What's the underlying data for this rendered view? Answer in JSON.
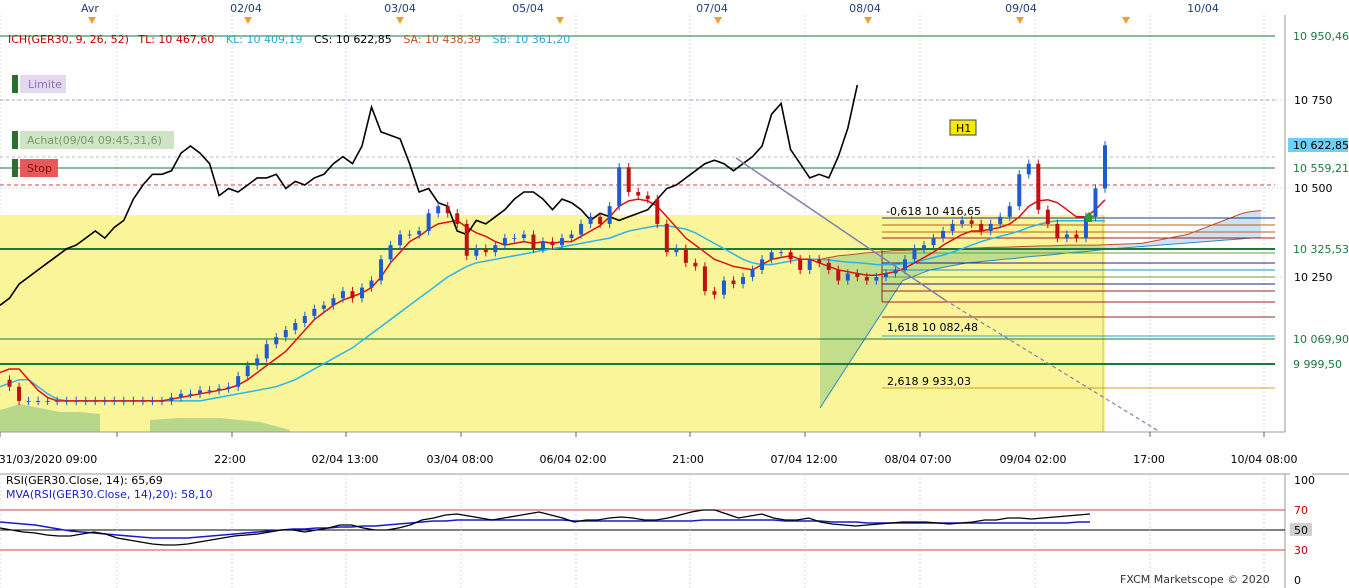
{
  "top_dates": [
    "Avr",
    "02/04",
    "03/04",
    "05/04",
    "07/04",
    "08/04",
    "09/04",
    "10/04"
  ],
  "header": {
    "ich": "ICH(GER30, 9, 26, 52)",
    "tl": "TL: 10 467,60",
    "kl": "KL: 10 409,19",
    "cs": "CS: 10 622,85",
    "sa": "SA: 10 438,39",
    "sb": "SB: 10 361,20"
  },
  "order_tags": {
    "limit": "Limite",
    "buy": "Achat(09/04 09:45,31,6)",
    "stop": "Stop"
  },
  "badge": "H1",
  "fib_labels": [
    "-0,618 10 416,65",
    "1,618 10 082,48",
    "2,618 9 933,03"
  ],
  "right_axis": {
    "labels": [
      "10 750",
      "10 500",
      "10 250"
    ],
    "tags": [
      {
        "text": "10 950,46",
        "bg": "#ffffff",
        "fg": "#1a7a3c"
      },
      {
        "text": "10 622,85",
        "bg": "#6fd0f5",
        "fg": "#000000"
      },
      {
        "text": "10 559,21",
        "bg": "#ffffff",
        "fg": "#1a7a3c"
      },
      {
        "text": "10 325,53",
        "bg": "#ffffff",
        "fg": "#1a7a3c"
      },
      {
        "text": "10 069,90",
        "bg": "#ffffff",
        "fg": "#1a7a3c"
      },
      {
        "text": "9 999,50",
        "bg": "#ffffff",
        "fg": "#1a7a3c"
      }
    ]
  },
  "bottom_axis": [
    "31/03/2020 09:00",
    "22:00",
    "02/04 13:00",
    "03/04 08:00",
    "06/04 02:00",
    "21:00",
    "07/04 12:00",
    "08/04 07:00",
    "09/04 02:00",
    "17:00",
    "10/04 08:00"
  ],
  "rsi": {
    "label1": "RSI(GER30.Close, 14): 65,69",
    "label2": "MVA(RSI(GER30.Close, 14),20): 58,10",
    "levels": [
      "100",
      "70",
      "50",
      "30",
      "0"
    ]
  },
  "footer": "FXCM Marketscope © 2020",
  "chart_data": {
    "type": "line",
    "instrument": "GER30",
    "y_range": [
      9880,
      11000
    ],
    "series": [
      {
        "name": "close",
        "values": [
          9960,
          9940,
          9900,
          9900,
          9900,
          9900,
          9900,
          9900,
          9900,
          9900,
          9900,
          9900,
          9900,
          9900,
          9900,
          9900,
          9900,
          9900,
          9910,
          9920,
          9920,
          9930,
          9930,
          9935,
          9940,
          9970,
          10000,
          10020,
          10060,
          10080,
          10100,
          10120,
          10140,
          10160,
          10170,
          10190,
          10210,
          10190,
          10220,
          10240,
          10300,
          10340,
          10370,
          10370,
          10380,
          10430,
          10450,
          10430,
          10400,
          10310,
          10330,
          10320,
          10340,
          10360,
          10360,
          10370,
          10330,
          10350,
          10340,
          10360,
          10370,
          10400,
          10420,
          10400,
          10450,
          10560,
          10490,
          10480,
          10470,
          10400,
          10320,
          10330,
          10290,
          10280,
          10210,
          10200,
          10240,
          10230,
          10250,
          10270,
          10300,
          10320,
          10320,
          10300,
          10270,
          10300,
          10290,
          10270,
          10240,
          10260,
          10250,
          10240,
          10250,
          10260,
          10270,
          10300,
          10330,
          10340,
          10360,
          10380,
          10400,
          10410,
          10400,
          10380,
          10400,
          10420,
          10450,
          10540,
          10570,
          10440,
          10400,
          10360,
          10370,
          10360,
          10420,
          10500,
          10622
        ]
      },
      {
        "name": "tenkan",
        "values": [
          9980,
          9990,
          9990,
          9960,
          9930,
          9910,
          9900,
          9900,
          9900,
          9900,
          9900,
          9900,
          9900,
          9900,
          9900,
          9900,
          9900,
          9900,
          9905,
          9910,
          9915,
          9920,
          9925,
          9930,
          9935,
          9945,
          9960,
          9980,
          10000,
          10020,
          10040,
          10070,
          10100,
          10130,
          10150,
          10170,
          10185,
          10195,
          10205,
          10220,
          10250,
          10290,
          10320,
          10350,
          10365,
          10385,
          10400,
          10405,
          10410,
          10390,
          10375,
          10365,
          10350,
          10340,
          10345,
          10350,
          10345,
          10350,
          10345,
          10350,
          10350,
          10365,
          10380,
          10395,
          10420,
          10450,
          10465,
          10470,
          10465,
          10450,
          10420,
          10390,
          10360,
          10340,
          10320,
          10300,
          10290,
          10280,
          10275,
          10270,
          10285,
          10300,
          10305,
          10310,
          10300,
          10300,
          10290,
          10280,
          10270,
          10265,
          10260,
          10255,
          10255,
          10260,
          10265,
          10275,
          10290,
          10305,
          10320,
          10340,
          10355,
          10370,
          10380,
          10380,
          10385,
          10390,
          10400,
          10420,
          10450,
          10465,
          10468,
          10460,
          10440,
          10420,
          10420,
          10440,
          10468
        ]
      },
      {
        "name": "kijun",
        "values": [
          9940,
          9950,
          9960,
          9960,
          9940,
          9920,
          9905,
          9900,
          9900,
          9900,
          9900,
          9900,
          9900,
          9900,
          9900,
          9900,
          9900,
          9900,
          9900,
          9900,
          9900,
          9900,
          9905,
          9910,
          9915,
          9920,
          9925,
          9930,
          9935,
          9940,
          9950,
          9960,
          9975,
          9990,
          10005,
          10020,
          10035,
          10050,
          10070,
          10090,
          10110,
          10130,
          10150,
          10170,
          10190,
          10210,
          10230,
          10250,
          10265,
          10280,
          10290,
          10295,
          10300,
          10305,
          10310,
          10315,
          10320,
          10325,
          10330,
          10335,
          10340,
          10345,
          10350,
          10355,
          10360,
          10370,
          10380,
          10385,
          10390,
          10395,
          10395,
          10390,
          10385,
          10375,
          10360,
          10345,
          10330,
          10315,
          10300,
          10290,
          10285,
          10285,
          10290,
          10295,
          10300,
          10300,
          10300,
          10298,
          10295,
          10292,
          10290,
          10288,
          10285,
          10285,
          10285,
          10288,
          10292,
          10298,
          10305,
          10312,
          10320,
          10330,
          10340,
          10350,
          10358,
          10365,
          10372,
          10380,
          10390,
          10398,
          10405,
          10409,
          10409,
          10409,
          10409,
          10409,
          10409
        ]
      },
      {
        "name": "span_a",
        "values": [
          null,
          null,
          null,
          null,
          null,
          null,
          null,
          null,
          null,
          null,
          null,
          null,
          null,
          null,
          null,
          null,
          null,
          null,
          null,
          null,
          null,
          null,
          null,
          null,
          null,
          null,
          null,
          null,
          null,
          null,
          null,
          null,
          null,
          null,
          null,
          null,
          null,
          null,
          null,
          null,
          null,
          null,
          null,
          null,
          null,
          null,
          null,
          null,
          null,
          null,
          null,
          null,
          null,
          null,
          null,
          null,
          null,
          null,
          null,
          null,
          null,
          null,
          null,
          null,
          null,
          null,
          null,
          null,
          null,
          null,
          null,
          null,
          null,
          null,
          null,
          null,
          null,
          null,
          null,
          null,
          null,
          null,
          10300,
          10305,
          10310,
          10312,
          10315,
          10318,
          10320,
          10322,
          10325,
          10325,
          10326,
          10327,
          10328,
          10329,
          10330,
          10330,
          10331,
          10332,
          10333,
          10334,
          10334,
          10335,
          10336,
          10337,
          10338,
          10338,
          10339,
          10340,
          10340,
          10340,
          10340,
          10341,
          10342,
          10343,
          10344,
          10345,
          10350,
          10355,
          10360,
          10365,
          10370,
          10380,
          10390,
          10400,
          10410,
          10420,
          10430,
          10435,
          10438
        ]
      },
      {
        "name": "span_b",
        "values": [
          null,
          null,
          null,
          null,
          null,
          null,
          null,
          null,
          null,
          null,
          null,
          null,
          null,
          null,
          null,
          null,
          null,
          null,
          null,
          null,
          null,
          null,
          null,
          null,
          null,
          null,
          null,
          null,
          null,
          null,
          null,
          null,
          null,
          null,
          null,
          null,
          null,
          null,
          null,
          null,
          null,
          null,
          null,
          null,
          null,
          null,
          null,
          null,
          null,
          null,
          null,
          null,
          null,
          null,
          null,
          null,
          null,
          null,
          null,
          null,
          null,
          null,
          null,
          null,
          null,
          null,
          null,
          null,
          null,
          null,
          null,
          null,
          null,
          null,
          null,
          null,
          null,
          null,
          null,
          null,
          null,
          null,
          9880,
          9920,
          9960,
          10000,
          10040,
          10080,
          10120,
          10160,
          10200,
          10240,
          10250,
          10260,
          10270,
          10275,
          10280,
          10285,
          10290,
          10292,
          10295,
          10297,
          10300,
          10302,
          10305,
          10308,
          10310,
          10312,
          10315,
          10318,
          10320,
          10322,
          10325,
          10328,
          10330,
          10332,
          10334,
          10336,
          10338,
          10340,
          10342,
          10344,
          10346,
          10348,
          10350,
          10352,
          10354,
          10356,
          10358,
          10360,
          10361
        ]
      }
    ],
    "levels": [
      10950.46,
      10750,
      10622.85,
      10559.21,
      10500,
      10416.65,
      10325.53,
      10250,
      10082.48,
      10069.9,
      9999.5,
      9933.03
    ],
    "rsi": {
      "range": [
        0,
        100
      ],
      "guides": [
        30,
        50,
        70
      ],
      "series": [
        {
          "name": "RSI(GER30.Close, 14)",
          "values": [
            52,
            50,
            48,
            47,
            45,
            44,
            44,
            46,
            48,
            46,
            42,
            40,
            38,
            36,
            35,
            35,
            36,
            38,
            40,
            42,
            44,
            45,
            46,
            48,
            50,
            50,
            48,
            50,
            52,
            55,
            55,
            52,
            50,
            50,
            52,
            55,
            60,
            62,
            65,
            66,
            64,
            62,
            60,
            62,
            64,
            66,
            68,
            65,
            62,
            58,
            60,
            60,
            62,
            63,
            62,
            60,
            60,
            62,
            65,
            68,
            70,
            70,
            66,
            62,
            64,
            66,
            62,
            60,
            60,
            62,
            58,
            56,
            55,
            54,
            55,
            56,
            57,
            58,
            58,
            58,
            57,
            56,
            57,
            58,
            60,
            60,
            62,
            62,
            61,
            62,
            63,
            64,
            65,
            66
          ]
        },
        {
          "name": "MVA(RSI(GER30.Close, 14),20)",
          "values": [
            58,
            57,
            56,
            55,
            53,
            51,
            49,
            48,
            47,
            46,
            45,
            44,
            43,
            42,
            42,
            42,
            42,
            43,
            44,
            45,
            46,
            47,
            48,
            49,
            50,
            51,
            51,
            52,
            52,
            53,
            53,
            54,
            54,
            55,
            56,
            57,
            58,
            59,
            59,
            60,
            60,
            60,
            60,
            60,
            60,
            60,
            60,
            60,
            60,
            59,
            59,
            59,
            59,
            59,
            59,
            59,
            59,
            59,
            59,
            59,
            60,
            60,
            60,
            60,
            60,
            60,
            60,
            59,
            59,
            59,
            59,
            58,
            58,
            58,
            57,
            57,
            57,
            57,
            57,
            57,
            57,
            57,
            57,
            57,
            57,
            57,
            57,
            57,
            57,
            57,
            57,
            57,
            58,
            58
          ]
        }
      ]
    }
  }
}
